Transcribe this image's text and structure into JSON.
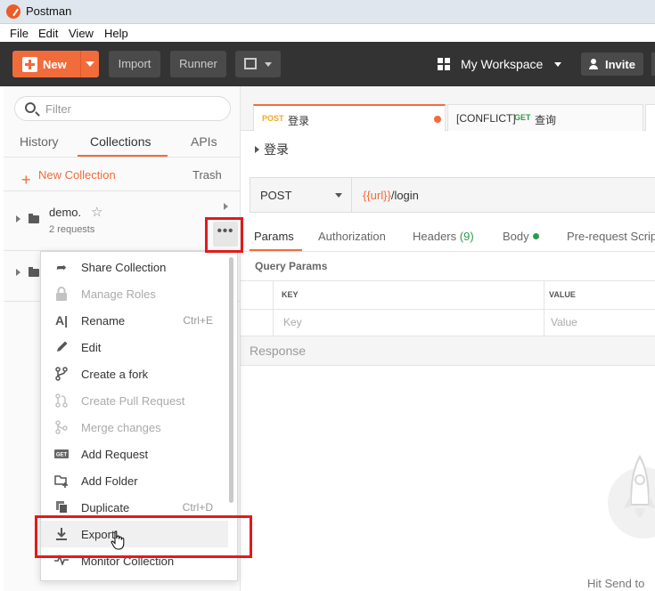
{
  "window": {
    "title": "Postman"
  },
  "menubar": [
    "File",
    "Edit",
    "View",
    "Help"
  ],
  "header": {
    "new_label": "New",
    "import_label": "Import",
    "runner_label": "Runner",
    "workspace_label": "My Workspace",
    "invite_label": "Invite",
    "accent_color": "#f26b3a"
  },
  "sidebar": {
    "filter_placeholder": "Filter",
    "tabs": [
      "History",
      "Collections",
      "APIs"
    ],
    "active_tab": "Collections",
    "new_collection_label": "New Collection",
    "trash_label": "Trash",
    "collections": [
      {
        "name": "demo.",
        "subtitle": "2 requests"
      }
    ]
  },
  "context_menu": {
    "items": [
      {
        "label": "Share Collection",
        "icon": "share-icon",
        "disabled": false,
        "shortcut": ""
      },
      {
        "label": "Manage Roles",
        "icon": "lock-icon",
        "disabled": true,
        "shortcut": ""
      },
      {
        "label": "Rename",
        "icon": "rename-icon",
        "disabled": false,
        "shortcut": "Ctrl+E"
      },
      {
        "label": "Edit",
        "icon": "pencil-icon",
        "disabled": false,
        "shortcut": ""
      },
      {
        "label": "Create a fork",
        "icon": "fork-icon",
        "disabled": false,
        "shortcut": ""
      },
      {
        "label": "Create Pull Request",
        "icon": "pull-request-icon",
        "disabled": true,
        "shortcut": ""
      },
      {
        "label": "Merge changes",
        "icon": "merge-icon",
        "disabled": true,
        "shortcut": ""
      },
      {
        "label": "Add Request",
        "icon": "get-request-icon",
        "disabled": false,
        "shortcut": ""
      },
      {
        "label": "Add Folder",
        "icon": "add-folder-icon",
        "disabled": false,
        "shortcut": ""
      },
      {
        "label": "Duplicate",
        "icon": "duplicate-icon",
        "disabled": false,
        "shortcut": "Ctrl+D"
      },
      {
        "label": "Export",
        "icon": "download-icon",
        "disabled": false,
        "shortcut": "",
        "hovered": true
      },
      {
        "label": "Monitor Collection",
        "icon": "pulse-icon",
        "disabled": false,
        "shortcut": ""
      }
    ]
  },
  "request_tabs": [
    {
      "method": "POST",
      "name": "登录",
      "unsaved": true,
      "active": true
    },
    {
      "prefix": "[CONFLICT]",
      "method": "GET",
      "name": "查询",
      "active": false
    }
  ],
  "request": {
    "title": "登录",
    "method": "POST",
    "url_var": "{{url}}",
    "url_path": "/login",
    "tabs": {
      "params": "Params",
      "authorization": "Authorization",
      "headers": "Headers",
      "headers_count": "(9)",
      "body": "Body",
      "pre_request": "Pre-request Script"
    },
    "query_params_title": "Query Params",
    "columns": [
      "KEY",
      "VALUE"
    ],
    "key_placeholder": "Key",
    "value_placeholder": "Value"
  },
  "response": {
    "label": "Response",
    "hint": "Hit Send to"
  }
}
